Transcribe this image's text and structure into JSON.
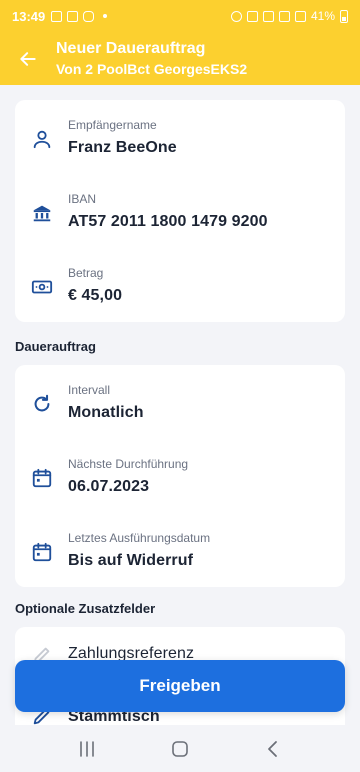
{
  "status_bar": {
    "time": "13:49",
    "battery": "41%"
  },
  "header": {
    "title": "Neuer Dauerauftrag",
    "subtitle": "Von 2 PoolBct GeorgesEKS2"
  },
  "recipient_card": {
    "rows": [
      {
        "label": "Empfängername",
        "value": "Franz BeeOne",
        "icon": "person-icon"
      },
      {
        "label": "IBAN",
        "value": "AT57 2011 1800 1479 9200",
        "icon": "bank-icon"
      },
      {
        "label": "Betrag",
        "value": "€ 45,00",
        "icon": "banknote-icon"
      }
    ]
  },
  "dauerauftrag": {
    "section_title": "Dauerauftrag",
    "rows": [
      {
        "label": "Intervall",
        "value": "Monatlich",
        "icon": "repeat-icon"
      },
      {
        "label": "Nächste Durchführung",
        "value": "06.07.2023",
        "icon": "calendar-icon"
      },
      {
        "label": "Letztes Ausführungsdatum",
        "value": "Bis auf Widerruf",
        "icon": "calendar-icon"
      }
    ]
  },
  "optional": {
    "section_title": "Optionale Zusatzfelder",
    "reference_label": "Zahlungsreferenz",
    "second_value": "Stammtisch"
  },
  "cta": {
    "label": "Freigeben"
  },
  "colors": {
    "header": "#fcd02f",
    "accent": "#1d6fdf",
    "icon": "#1f4f9a"
  }
}
